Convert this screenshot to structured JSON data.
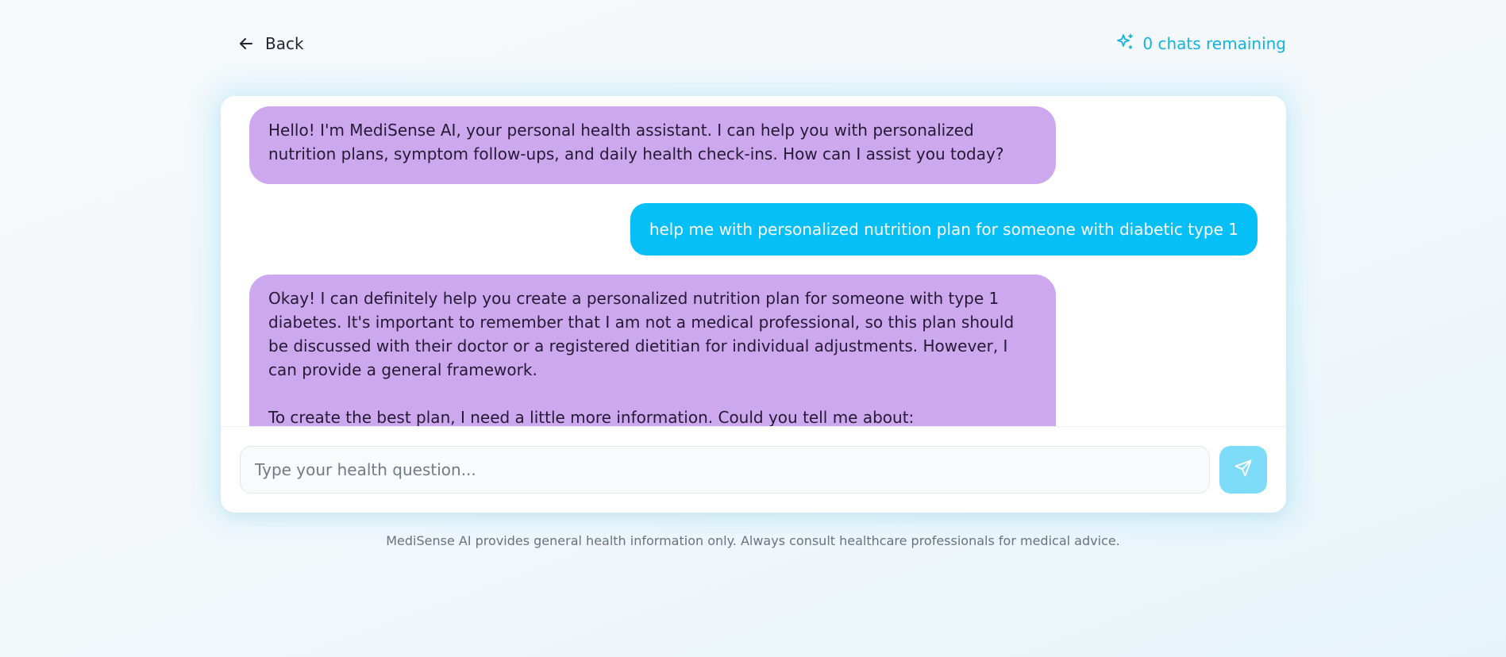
{
  "header": {
    "back_label": "Back",
    "back_icon": "arrow-left-icon",
    "chats_remaining_label": "0 chats remaining",
    "chats_icon": "sparkles-icon"
  },
  "messages": [
    {
      "role": "assistant",
      "paragraphs": [
        "Hello! I'm MediSense AI, your personal health assistant. I can help you with personalized nutrition plans, symptom follow-ups, and daily health check-ins. How can I assist you today?"
      ]
    },
    {
      "role": "user",
      "paragraphs": [
        "help me with personalized nutrition plan for someone with diabetic type 1"
      ]
    },
    {
      "role": "assistant",
      "paragraphs": [
        "Okay! I can definitely help you create a personalized nutrition plan for someone with type 1 diabetes. It's important to remember that I am not a medical professional, so this plan should be discussed with their doctor or a registered dietitian for individual adjustments. However, I can provide a general framework.",
        "To create the best plan, I need a little more information. Could you tell me about:"
      ]
    }
  ],
  "composer": {
    "placeholder": "Type your health question...",
    "value": "",
    "send_icon": "send-icon"
  },
  "footer": {
    "disclaimer": "MediSense AI provides general health information only. Always consult healthcare professionals for medical advice."
  },
  "colors": {
    "accent": "#05bff6",
    "assistant_bubble": "#cda8ef",
    "send_button": "#7fdcf8",
    "chats_remaining_text": "#12b3dc"
  }
}
